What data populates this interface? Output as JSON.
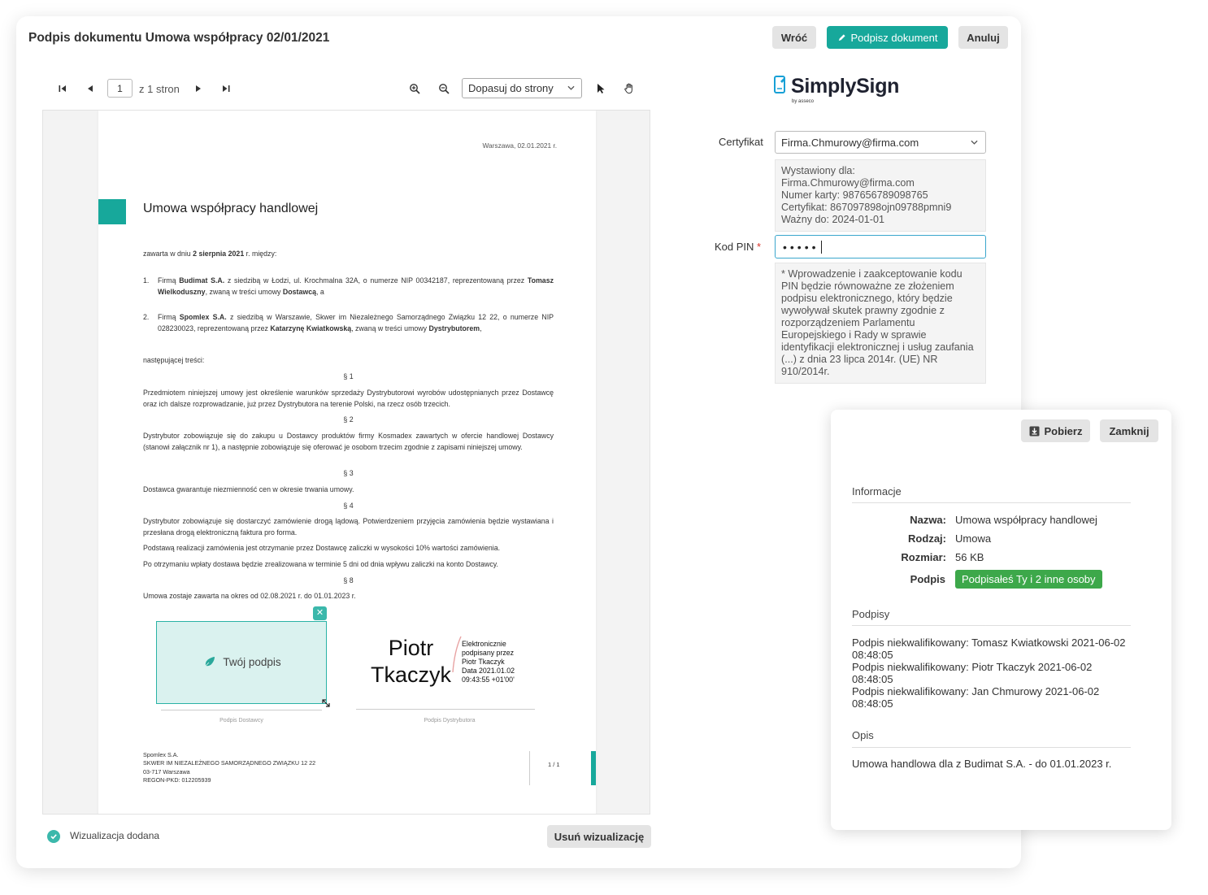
{
  "header": {
    "title": "Podpis dokumentu Umowa współpracy 02/01/2021",
    "back_label": "Wróć",
    "sign_label": "Podpisz dokument",
    "cancel_label": "Anuluj"
  },
  "toolbar": {
    "page_value": "1",
    "page_total": "z 1 stron",
    "zoom_option": "Dopasuj do strony"
  },
  "document": {
    "date": "Warszawa, 02.01.2021 r.",
    "title": "Umowa współpracy handlowej",
    "intro_pre": "zawarta w dniu ",
    "intro_bold": "2 sierpnia 2021",
    "intro_post": " r. między:",
    "party1_num": "1.",
    "party1_pre": "Firmą ",
    "party1_b1": "Budimat S.A.",
    "party1_mid": " z siedzibą w Łodzi, ul. Krochmalna 32A, o numerze NIP 00342187, reprezentowaną przez ",
    "party1_b2": "Tomasz Wielkoduszny",
    "party1_mid2": ", zwaną w treści umowy ",
    "party1_b3": "Dostawcą",
    "party1_post": ", a",
    "party2_num": "2.",
    "party2_pre": "Firmą ",
    "party2_b1": "Spomlex S.A.",
    "party2_mid": " z siedzibą w Warszawie, Skwer im Niezależnego Samorządnego Związku 12 22, o numerze NIP 028230023, reprezentowaną przez ",
    "party2_b2": "Katarzynę Kwiatkowską",
    "party2_mid2": ", zwaną w treści umowy ",
    "party2_b3": "Dystrybutorem",
    "party2_post": ",",
    "following": "następującej treści:",
    "s1": "§ 1",
    "p1": "Przedmiotem niniejszej umowy jest określenie warunków sprzedaży Dystrybutorowi wyrobów udostępnianych przez Dostawcę oraz ich dalsze rozprowadzanie, już przez Dystrybutora na terenie Polski, na rzecz osób trzecich.",
    "s2": "§ 2",
    "p2": "Dystrybutor zobowiązuje się do zakupu u Dostawcy produktów firmy Kosmadex zawartych w ofercie handlowej Dostawcy (stanowi załącznik nr 1), a następnie zobowiązuje się oferować je osobom trzecim zgodnie z zapisami niniejszej umowy.",
    "s3": "§ 3",
    "p3": "Dostawca gwarantuje niezmienność cen w okresie trwania umowy.",
    "s4": "§ 4",
    "p4a": "Dystrybutor zobowiązuje się dostarczyć zamówienie drogą lądową. Potwierdzeniem przyjęcia zamówienia będzie wystawiana i przesłana drogą elektroniczną faktura pro forma.",
    "p4b": "Podstawą realizacji zamówienia jest otrzymanie przez Dostawcę zaliczki w wysokości 10% wartości zamówienia.",
    "p4c": "Po otrzymaniu wpłaty dostawa będzie zrealizowana w terminie 5 dni od dnia wpływu zaliczki na konto Dostawcy.",
    "s8": "§ 8",
    "p8": "Umowa zostaje zawarta na okres od 02.08.2021 r. do 01.01.2023 r.",
    "your_signature": "Twój podpis",
    "caption_left": "Podpis Dostawcy",
    "caption_right": "Podpis Dystrybutora",
    "signer_name_1": "Piotr",
    "signer_name_2": "Tkaczyk",
    "esign_1": "Elektronicznie",
    "esign_2": "podpisany przez",
    "esign_3": "Piotr Tkaczyk",
    "esign_4": "Data 2021.01.02",
    "esign_5": "09:43:55 +01'00'",
    "footer_1": "Spomlex S.A.",
    "footer_2": "SKWER IM NIEZALEŻNEGO SAMORZĄDNEGO ZWIĄZKU 12 22",
    "footer_3": "03-717 Warszawa",
    "footer_4": "REGON-PKD: 012205939",
    "footer_page": "1 / 1"
  },
  "bottom": {
    "viz_added": "Wizualizacja dodana",
    "remove_viz": "Usuń wizualizację"
  },
  "brand": {
    "name": "SimplySign",
    "sub": "by asseco"
  },
  "form": {
    "cert_label": "Certyfikat",
    "cert_value": "Firma.Chmurowy@firma.com",
    "cert_info": [
      "Wystawiony dla:",
      "Firma.Chmurowy@firma.com",
      "Numer karty: 987656789098765",
      "Certyfikat: 867097898ojn09788pmni9",
      "Ważny do: 2024-01-01"
    ],
    "pin_label": "Kod PIN",
    "pin_required": "*",
    "pin_value": "•••••",
    "note": "* Wprowadzenie i zaakceptowanie kodu PIN będzie równoważne ze złożeniem podpisu elektronicznego, który będzie wywoływał skutek prawny zgodnie z rozporządzeniem Parlamentu Europejskiego i Rady w sprawie identyfikacji elektronicznej i usług zaufania (...) z dnia 23 lipca 2014r. (UE) NR 910/2014r."
  },
  "panel": {
    "download_label": "Pobierz",
    "close_label": "Zamknij",
    "info_title": "Informacje",
    "name_key": "Nazwa:",
    "name_val": "Umowa współpracy handlowej",
    "type_key": "Rodzaj:",
    "type_val": "Umowa",
    "size_key": "Rozmiar:",
    "size_val": "56 KB",
    "sign_key": "Podpis",
    "sign_badge": "Podpisałeś Ty i 2 inne osoby",
    "signatures_title": "Podpisy",
    "signatures": [
      "Podpis niekwalifikowany: Tomasz Kwiatkowski 2021-06-02 08:48:05",
      "Podpis niekwalifikowany: Piotr Tkaczyk 2021-06-02 08:48:05",
      "Podpis niekwalifikowany: Jan Chmurowy  2021-06-02 08:48:05"
    ],
    "desc_title": "Opis",
    "desc": "Umowa handlowa dla z Budimat S.A. - do 01.01.2023 r."
  },
  "colors": {
    "accent": "#17a89b",
    "badge": "#3da84a",
    "required": "#d9352b",
    "pin_border": "#3aa6cc"
  }
}
